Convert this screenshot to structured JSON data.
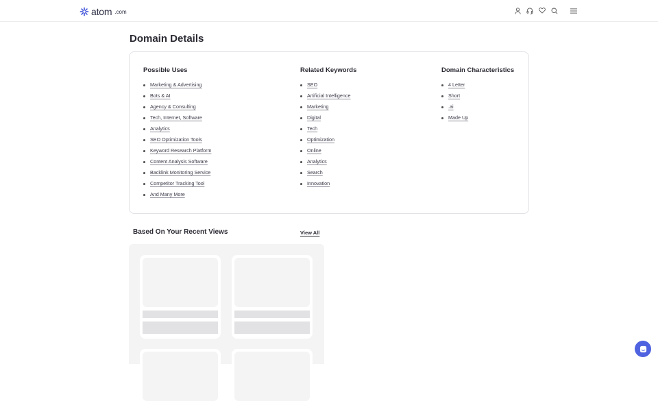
{
  "header": {
    "logo_word": "atom",
    "logo_tld": ".com",
    "icons": [
      "user-icon",
      "headset-icon",
      "heart-icon",
      "search-icon",
      "menu-icon"
    ]
  },
  "page_title": "Domain Details",
  "details": {
    "possible_uses": {
      "title": "Possible Uses",
      "items": [
        "Marketing & Advertising",
        "Bots & AI",
        "Agency & Consulting",
        "Tech, Internet, Software",
        "Analytics",
        "SEO Optimization Tools",
        "Keyword Research Platform",
        "Content Analysis Software",
        "Backlink Monitoring Service",
        "Competitor Tracking Tool",
        "And Many More"
      ]
    },
    "related_keywords": {
      "title": "Related Keywords",
      "items": [
        "SEO",
        "Artificial Intelligence",
        "Marketing",
        "Digital",
        "Tech",
        "Optimization",
        "Online",
        "Analytics",
        "Search",
        "Innovation"
      ]
    },
    "characteristics": {
      "title": "Domain Characteristics",
      "items": [
        "4 Letter",
        "Short",
        ".ai",
        "Made Up"
      ]
    }
  },
  "recent": {
    "title": "Based On Your Recent Views",
    "view_all": "View All"
  },
  "colors": {
    "accent": "#4f63e0",
    "text": "#2a2a33",
    "skeleton": "#e2e2e4"
  }
}
